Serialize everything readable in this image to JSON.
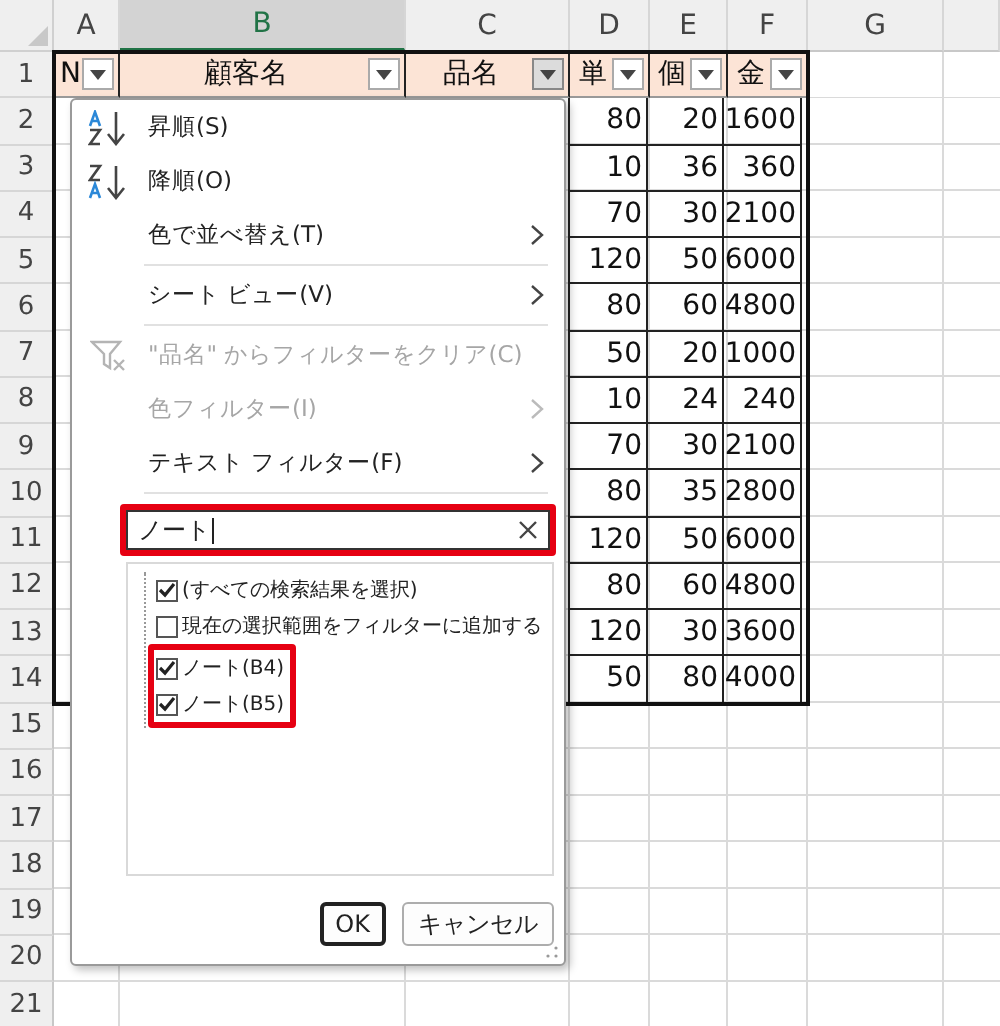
{
  "sheet": {
    "columns": [
      {
        "label": "A",
        "selected": false
      },
      {
        "label": "B",
        "selected": true
      },
      {
        "label": "C",
        "selected": false
      },
      {
        "label": "D",
        "selected": false
      },
      {
        "label": "E",
        "selected": false
      },
      {
        "label": "F",
        "selected": false
      },
      {
        "label": "G",
        "selected": false
      }
    ],
    "row_numbers": [
      "1",
      "2",
      "3",
      "4",
      "5",
      "6",
      "7",
      "8",
      "9",
      "10",
      "11",
      "12",
      "13",
      "14",
      "15",
      "16",
      "17",
      "18",
      "19",
      "20",
      "21"
    ],
    "headers": [
      {
        "label": "N",
        "filter_active": false
      },
      {
        "label": "顧客名",
        "filter_active": false
      },
      {
        "label": "品名",
        "filter_active": true
      },
      {
        "label": "単",
        "filter_active": false
      },
      {
        "label": "個",
        "filter_active": false
      },
      {
        "label": "金",
        "filter_active": false
      }
    ],
    "rows": [
      [
        "80",
        "20",
        "1600"
      ],
      [
        "10",
        "36",
        "360"
      ],
      [
        "70",
        "30",
        "2100"
      ],
      [
        "120",
        "50",
        "6000"
      ],
      [
        "80",
        "60",
        "4800"
      ],
      [
        "50",
        "20",
        "1000"
      ],
      [
        "10",
        "24",
        "240"
      ],
      [
        "70",
        "30",
        "2100"
      ],
      [
        "80",
        "35",
        "2800"
      ],
      [
        "120",
        "50",
        "6000"
      ],
      [
        "80",
        "60",
        "4800"
      ],
      [
        "120",
        "30",
        "3600"
      ],
      [
        "50",
        "80",
        "4000"
      ]
    ]
  },
  "filter_menu": {
    "items": [
      {
        "kind": "sort_asc",
        "label": "昇順(S)",
        "disabled": false,
        "submenu": false
      },
      {
        "kind": "sort_desc",
        "label": "降順(O)",
        "disabled": false,
        "submenu": false
      },
      {
        "kind": "item",
        "label": "色で並べ替え(T)",
        "disabled": false,
        "submenu": true
      },
      {
        "kind": "separator"
      },
      {
        "kind": "item",
        "label": "シート ビュー(V)",
        "disabled": false,
        "submenu": true
      },
      {
        "kind": "separator"
      },
      {
        "kind": "clear_filter",
        "label": "\"品名\" からフィルターをクリア(C)",
        "disabled": true,
        "submenu": false
      },
      {
        "kind": "item",
        "label": "色フィルター(I)",
        "disabled": true,
        "submenu": true
      },
      {
        "kind": "item",
        "label": "テキスト フィルター(F)",
        "disabled": false,
        "submenu": true
      },
      {
        "kind": "separator"
      }
    ],
    "search": {
      "value": "ノート",
      "highlighted": true
    },
    "checklist": [
      {
        "label": "(すべての検索結果を選択)",
        "checked": true,
        "highlighted": false
      },
      {
        "label": "現在の選択範囲をフィルターに追加する",
        "checked": false,
        "highlighted": false
      },
      {
        "label": "ノート(B4)",
        "checked": true,
        "highlighted": true
      },
      {
        "label": "ノート(B5)",
        "checked": true,
        "highlighted": true
      }
    ],
    "buttons": [
      {
        "label": "OK",
        "default": true
      },
      {
        "label": "キャンセル",
        "default": false
      }
    ]
  }
}
